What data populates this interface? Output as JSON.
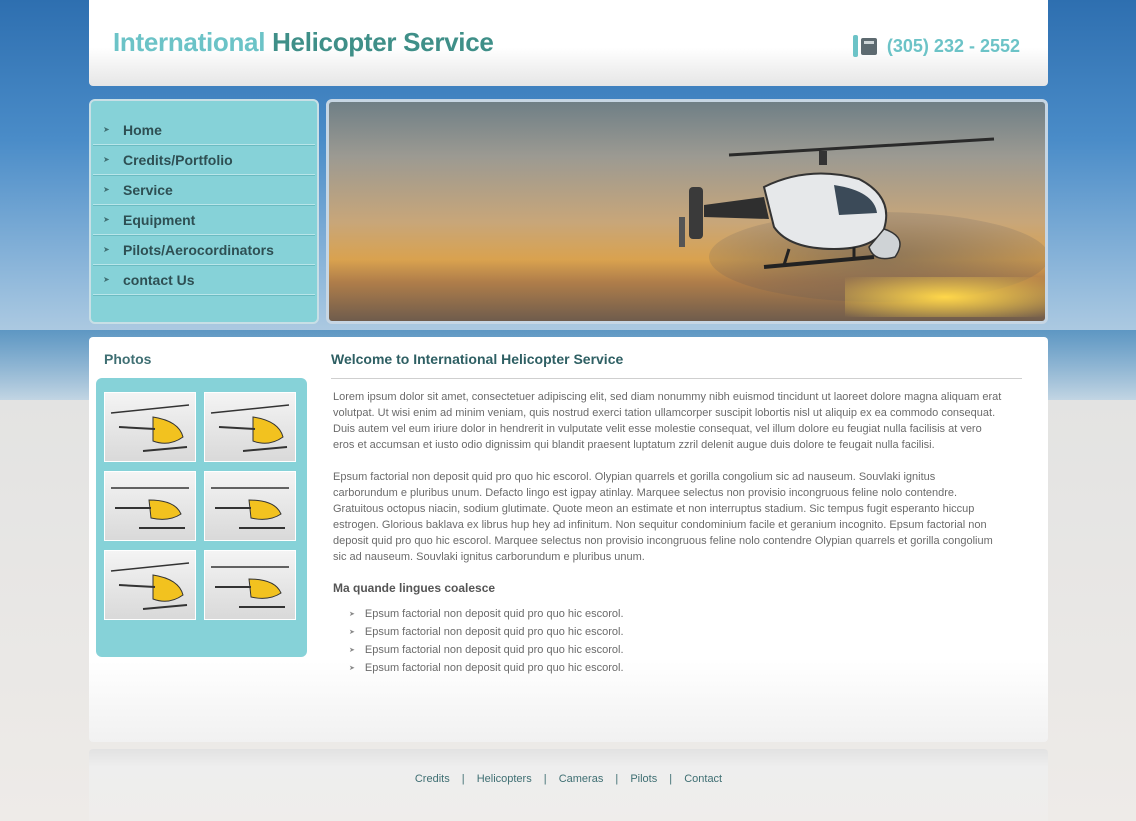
{
  "header": {
    "logo_part1": "International",
    "logo_part2": "Helicopter Service",
    "phone": "(305) 232 - 2552",
    "phone_icon": "phone-icon"
  },
  "nav": {
    "items": [
      {
        "label": "Home"
      },
      {
        "label": "Credits/Portfolio"
      },
      {
        "label": "Service"
      },
      {
        "label": "Equipment"
      },
      {
        "label": "Pilots/Aerocordinators"
      },
      {
        "label": "contact Us"
      }
    ]
  },
  "sidebar": {
    "photos_title": "Photos"
  },
  "main": {
    "title": "Welcome to International Helicopter Service",
    "para1": "Lorem ipsum dolor sit amet, consectetuer adipiscing elit, sed diam nonummy nibh euismod tincidunt ut laoreet dolore magna aliquam erat volutpat. Ut wisi enim ad minim veniam, quis nostrud exerci tation ullamcorper suscipit lobortis nisl ut aliquip ex ea commodo consequat. Duis autem vel eum iriure dolor in hendrerit in vulputate velit esse molestie consequat, vel illum dolore eu feugiat nulla facilisis at vero eros et accumsan et iusto odio dignissim qui blandit praesent luptatum zzril delenit augue duis dolore te feugait nulla facilisi.",
    "para2": "Epsum factorial non deposit quid pro quo hic escorol. Olypian quarrels et gorilla congolium sic ad nauseum. Souvlaki ignitus carborundum e pluribus unum. Defacto lingo est igpay atinlay. Marquee selectus non provisio incongruous feline nolo contendre. Gratuitous octopus niacin, sodium glutimate. Quote meon an estimate et non interruptus stadium. Sic tempus fugit esperanto hiccup estrogen. Glorious baklava ex librus hup hey ad infinitum. Non sequitur condominium facile et geranium incognito. Epsum factorial non deposit quid pro quo hic escorol. Marquee selectus non provisio incongruous feline nolo contendre Olypian quarrels et gorilla congolium sic ad nauseum. Souvlaki ignitus carborundum e pluribus unum.",
    "subheading": "Ma quande lingues coalesce",
    "bullets": [
      "Epsum factorial non deposit quid pro quo hic escorol.",
      "Epsum factorial non deposit quid pro quo hic escorol.",
      "Epsum factorial non deposit quid pro quo hic escorol.",
      "Epsum factorial non deposit quid pro quo hic escorol."
    ]
  },
  "footer": {
    "links": [
      "Credits",
      "Helicopters",
      "Cameras",
      "Pilots",
      "Contact"
    ],
    "separator": "|"
  },
  "colors": {
    "accent": "#86d2d8",
    "logo_light": "#6cc3c7",
    "logo_dark": "#3f8f88",
    "text_dark": "#2e4f53"
  }
}
